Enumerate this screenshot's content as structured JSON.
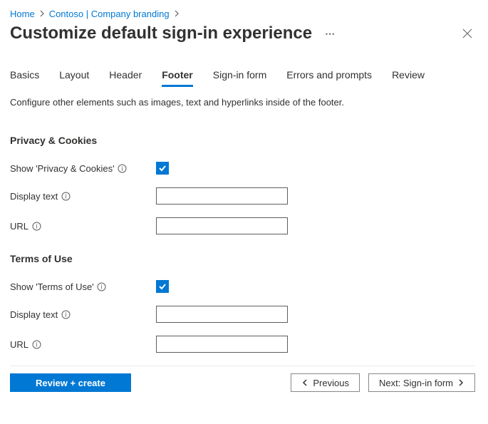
{
  "breadcrumb": {
    "home": "Home",
    "item": "Contoso | Company branding"
  },
  "page": {
    "title": "Customize default sign-in experience"
  },
  "tabs": {
    "basics": "Basics",
    "layout": "Layout",
    "header": "Header",
    "footer": "Footer",
    "signin": "Sign-in form",
    "errors": "Errors and prompts",
    "review": "Review"
  },
  "description": "Configure other elements such as images, text and hyperlinks inside of the footer.",
  "sections": {
    "privacy": {
      "title": "Privacy & Cookies",
      "show_label": "Show 'Privacy & Cookies'",
      "display_text_label": "Display text",
      "url_label": "URL"
    },
    "tou": {
      "title": "Terms of Use",
      "show_label": "Show 'Terms of Use'",
      "display_text_label": "Display text",
      "url_label": "URL"
    }
  },
  "buttons": {
    "review_create": "Review + create",
    "previous": "Previous",
    "next": "Next: Sign-in form"
  }
}
